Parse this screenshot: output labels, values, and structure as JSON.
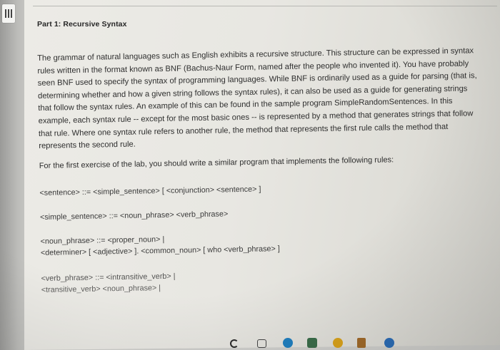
{
  "document": {
    "heading": "Part 1: Recursive Syntax",
    "paragraph_lines": [
      "The grammar of natural languages such as English exhibits a recursive structure. This structure can be expressed in syntax",
      "rules written in the format known as BNF (Bachus-Naur Form, named after the people who invented it). You have probably",
      "seen BNF used to specify the syntax of programming languages. While BNF is ordinarily used as a guide for parsing (that is,",
      "determining whether and how a given string follows the syntax rules), it can also be used as a guide for generating strings",
      "that follow the syntax rules. An example of this can be found in the sample program SimpleRandomSentences. In this",
      "example, each syntax rule -- except for the most basic ones -- is represented by a method that generates strings that follow",
      "that rule. Where one syntax rule refers to another rule, the method that represents the first rule calls the method that",
      "represents the second rule."
    ],
    "instruction": "For the first exercise of the lab, you should write a similar program that implements the following rules:",
    "rules": [
      "<sentence> ::= <simple_sentence> [ <conjunction> <sentence> ]",
      "<simple_sentence> ::= <noun_phrase> <verb_phrase>",
      "<noun_phrase> ::= <proper_noun> |",
      "<determiner> [ <adjective> ]. <common_noun> [ who <verb_phrase> ]",
      "<verb_phrase> ::= <intransitive_verb> |",
      "<transitive_verb> <noun_phrase> |"
    ]
  },
  "taskbar": {
    "icons": [
      {
        "name": "refresh-icon",
        "color": "#2a2a2a"
      },
      {
        "name": "task-view-icon",
        "color": "#444444"
      },
      {
        "name": "edge-icon",
        "color": "#1f7fbf"
      },
      {
        "name": "store-icon",
        "color": "#3a6d4a"
      },
      {
        "name": "chrome-icon",
        "color": "#d9a21b"
      },
      {
        "name": "app-icon",
        "color": "#2b6cb5"
      }
    ]
  }
}
